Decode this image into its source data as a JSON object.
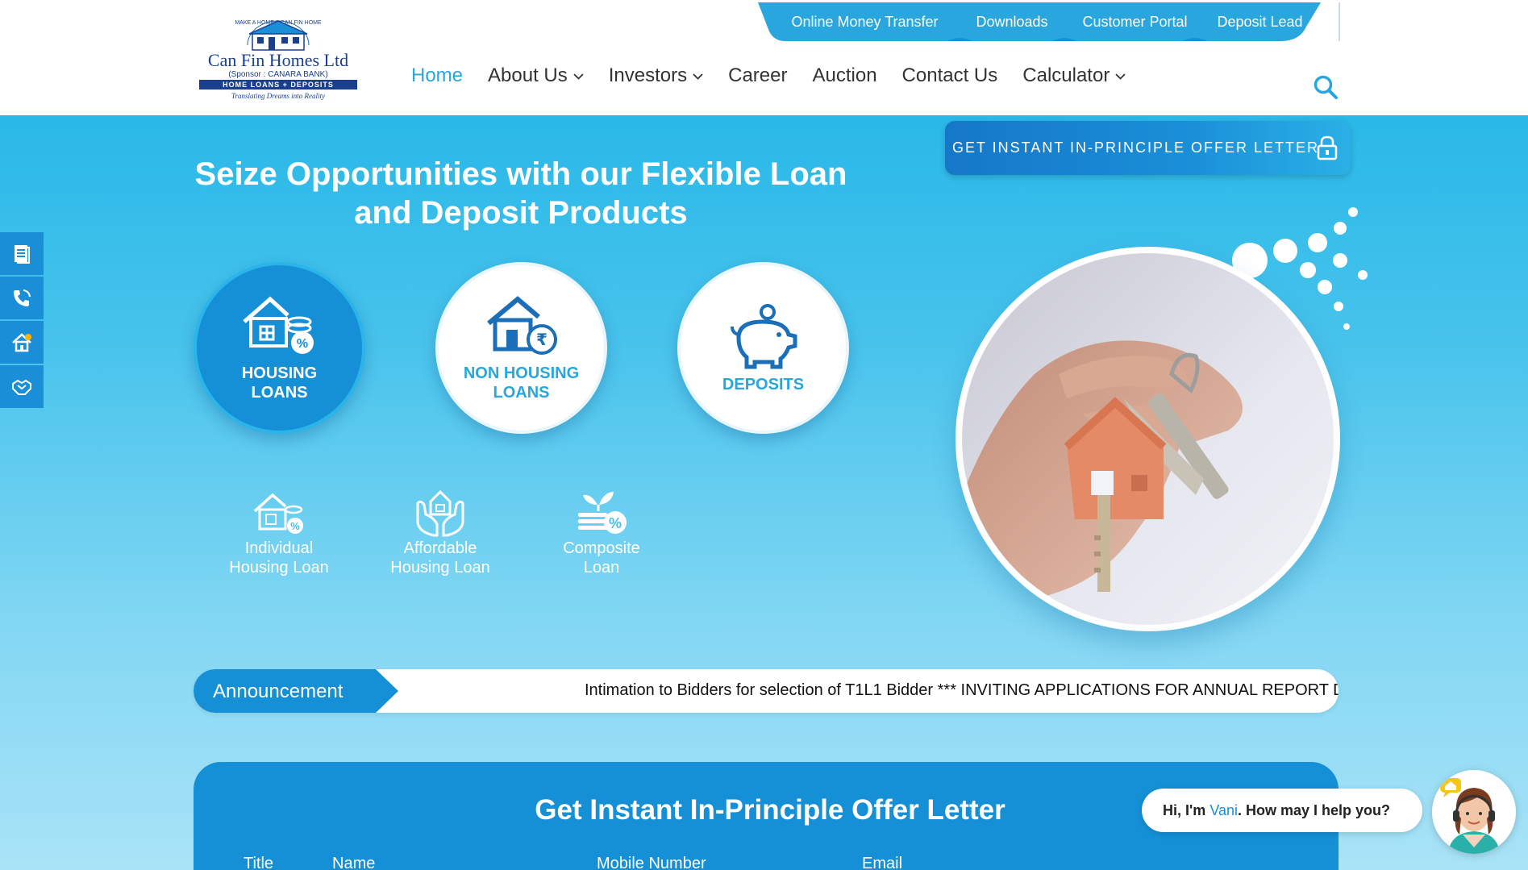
{
  "brand": {
    "logo_tagline_top": "MAKE A HOME A CAN FIN HOME",
    "name": "Can Fin Homes Ltd",
    "sponsor": "(Sponsor : CANARA BANK)",
    "strip": "HOME LOANS + DEPOSITS",
    "tagline": "Translating Dreams into Reality"
  },
  "utility_nav": [
    "Online Money Transfer",
    "Downloads",
    "Customer Portal",
    "Deposit Lead"
  ],
  "main_nav": [
    {
      "label": "Home",
      "active": true,
      "dropdown": false
    },
    {
      "label": "About Us",
      "active": false,
      "dropdown": true
    },
    {
      "label": "Investors",
      "active": false,
      "dropdown": true
    },
    {
      "label": "Career",
      "active": false,
      "dropdown": false
    },
    {
      "label": "Auction",
      "active": false,
      "dropdown": false
    },
    {
      "label": "Contact Us",
      "active": false,
      "dropdown": false
    },
    {
      "label": "Calculator",
      "active": false,
      "dropdown": true
    }
  ],
  "hero": {
    "title_line1": "Seize Opportunities with our Flexible Loan",
    "title_line2": "and Deposit Products",
    "offer_button": "GET INSTANT IN-PRINCIPLE OFFER LETTER"
  },
  "products": [
    {
      "line1": "HOUSING",
      "line2": "LOANS",
      "icon": "housing-loan-icon",
      "selected": true
    },
    {
      "line1": "NON HOUSING",
      "line2": "LOANS",
      "icon": "non-housing-loan-icon",
      "selected": false
    },
    {
      "line1": "DEPOSITS",
      "line2": "",
      "icon": "piggy-bank-icon",
      "selected": false
    }
  ],
  "sub_products": [
    {
      "line1": "Individual",
      "line2": "Housing Loan",
      "icon": "individual-housing-icon"
    },
    {
      "line1": "Affordable",
      "line2": "Housing Loan",
      "icon": "affordable-housing-icon"
    },
    {
      "line1": "Composite",
      "line2": "Loan",
      "icon": "composite-loan-icon"
    }
  ],
  "announcement": {
    "label": "Announcement",
    "ticker": "Intimation to Bidders for selection of T1L1 Bidder *** INVITING APPLICATIONS FOR ANNUAL REPORT D"
  },
  "form": {
    "title": "Get Instant In-Principle Offer Letter",
    "labels": [
      "Title",
      "Name",
      "Mobile Number",
      "Email"
    ]
  },
  "chat": {
    "prefix": "Hi, I'm ",
    "name": "Vani",
    "suffix": ". How may I help you?"
  },
  "side_tools": [
    "document-icon",
    "phone-icon",
    "home-icon",
    "handshake-icon"
  ],
  "colors": {
    "primary": "#1a8fd8",
    "accent": "#29a6dd",
    "hero_top": "#29b8e8",
    "hero_bottom": "#a9e3f7"
  }
}
